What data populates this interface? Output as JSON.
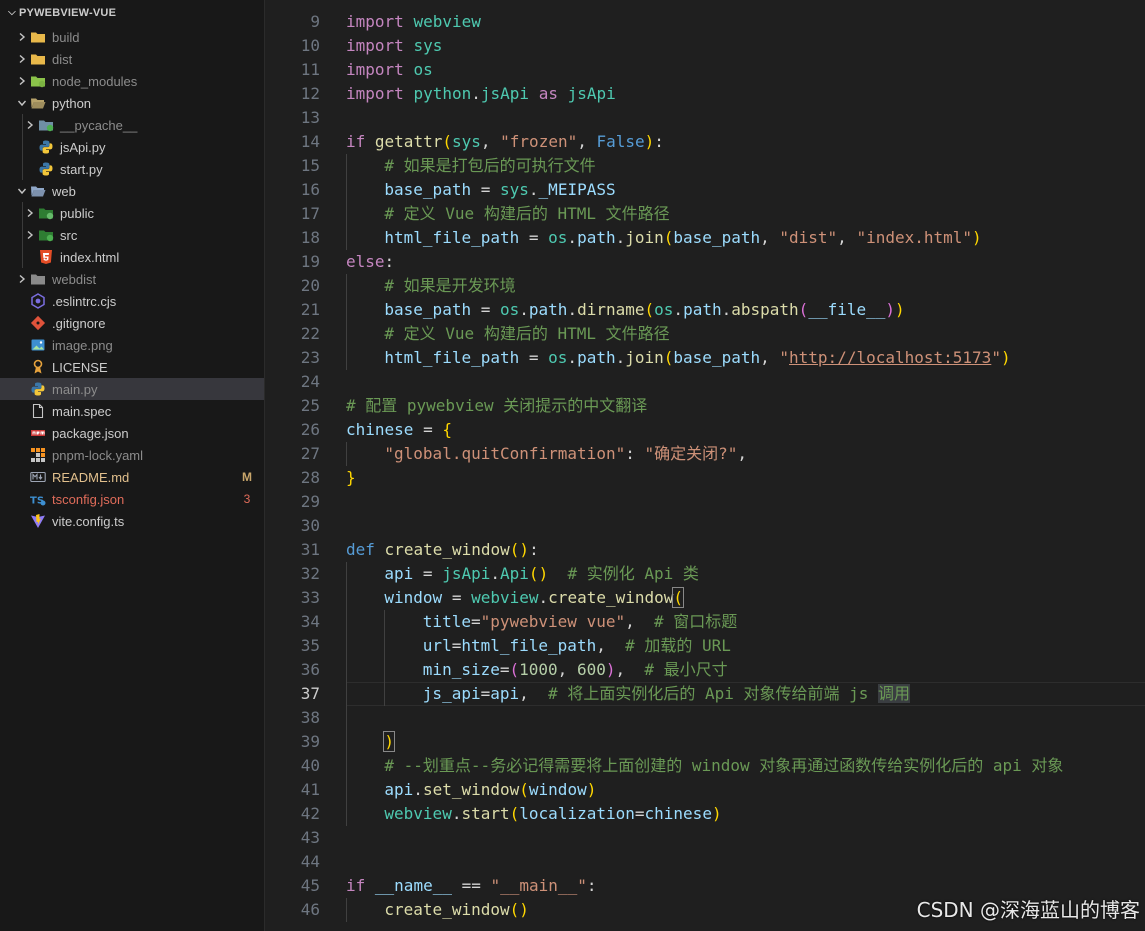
{
  "explorer": {
    "title": "PYWEBVIEW-VUE",
    "items": [
      {
        "label": "build",
        "kind": "folder",
        "icon": "folder-build-icon",
        "depth": 0,
        "expanded": false
      },
      {
        "label": "dist",
        "kind": "folder",
        "icon": "folder-dist-icon",
        "depth": 0,
        "expanded": false
      },
      {
        "label": "node_modules",
        "kind": "folder",
        "icon": "folder-node-icon",
        "depth": 0,
        "expanded": false
      },
      {
        "label": "python",
        "kind": "folder",
        "icon": "folder-python-icon",
        "depth": 0,
        "expanded": true
      },
      {
        "label": "__pycache__",
        "kind": "folder",
        "icon": "folder-pycache-icon",
        "depth": 1,
        "expanded": false
      },
      {
        "label": "jsApi.py",
        "kind": "file",
        "icon": "python-file-icon",
        "depth": 1
      },
      {
        "label": "start.py",
        "kind": "file",
        "icon": "python-file-icon",
        "depth": 1
      },
      {
        "label": "web",
        "kind": "folder",
        "icon": "folder-web-icon",
        "depth": 0,
        "expanded": true
      },
      {
        "label": "public",
        "kind": "folder",
        "icon": "folder-public-icon",
        "depth": 1,
        "expanded": false
      },
      {
        "label": "src",
        "kind": "folder",
        "icon": "folder-src-icon",
        "depth": 1,
        "expanded": false
      },
      {
        "label": "index.html",
        "kind": "file",
        "icon": "html-file-icon",
        "depth": 1
      },
      {
        "label": "webdist",
        "kind": "folder",
        "icon": "folder-icon",
        "depth": 0,
        "expanded": false
      },
      {
        "label": ".eslintrc.cjs",
        "kind": "file",
        "icon": "eslint-file-icon",
        "depth": 0
      },
      {
        "label": ".gitignore",
        "kind": "file",
        "icon": "git-file-icon",
        "depth": 0
      },
      {
        "label": "image.png",
        "kind": "file",
        "icon": "image-file-icon",
        "depth": 0
      },
      {
        "label": "LICENSE",
        "kind": "file",
        "icon": "license-file-icon",
        "depth": 0
      },
      {
        "label": "main.py",
        "kind": "file",
        "icon": "python-file-icon",
        "depth": 0,
        "selected": true
      },
      {
        "label": "main.spec",
        "kind": "file",
        "icon": "generic-file-icon",
        "depth": 0
      },
      {
        "label": "package.json",
        "kind": "file",
        "icon": "npm-file-icon",
        "depth": 0
      },
      {
        "label": "pnpm-lock.yaml",
        "kind": "file",
        "icon": "pnpm-file-icon",
        "depth": 0
      },
      {
        "label": "README.md",
        "kind": "file",
        "icon": "markdown-file-icon",
        "depth": 0,
        "badge": "M",
        "status": "modified"
      },
      {
        "label": "tsconfig.json",
        "kind": "file",
        "icon": "typescript-config-icon",
        "depth": 0,
        "badge": "3",
        "status": "error"
      },
      {
        "label": "vite.config.ts",
        "kind": "file",
        "icon": "vite-file-icon",
        "depth": 0
      }
    ]
  },
  "editor": {
    "active_line": 37,
    "lines": [
      {
        "n": 9,
        "indent": 0,
        "tokens": [
          [
            "kw2",
            "import"
          ],
          [
            "plain",
            " "
          ],
          [
            "mod",
            "webview"
          ]
        ]
      },
      {
        "n": 10,
        "indent": 0,
        "tokens": [
          [
            "kw2",
            "import"
          ],
          [
            "plain",
            " "
          ],
          [
            "mod",
            "sys"
          ]
        ]
      },
      {
        "n": 11,
        "indent": 0,
        "tokens": [
          [
            "kw2",
            "import"
          ],
          [
            "plain",
            " "
          ],
          [
            "mod",
            "os"
          ]
        ]
      },
      {
        "n": 12,
        "indent": 0,
        "tokens": [
          [
            "kw2",
            "import"
          ],
          [
            "plain",
            " "
          ],
          [
            "mod",
            "python"
          ],
          [
            "plain",
            "."
          ],
          [
            "mod",
            "jsApi"
          ],
          [
            "plain",
            " "
          ],
          [
            "kw2",
            "as"
          ],
          [
            "plain",
            " "
          ],
          [
            "mod",
            "jsApi"
          ]
        ]
      },
      {
        "n": 13,
        "indent": 0,
        "tokens": []
      },
      {
        "n": 14,
        "indent": 0,
        "tokens": [
          [
            "kw2",
            "if"
          ],
          [
            "plain",
            " "
          ],
          [
            "fn",
            "getattr"
          ],
          [
            "b1",
            "("
          ],
          [
            "mod",
            "sys"
          ],
          [
            "plain",
            ", "
          ],
          [
            "str",
            "\"frozen\""
          ],
          [
            "plain",
            ", "
          ],
          [
            "kw",
            "False"
          ],
          [
            "b1",
            ")"
          ],
          [
            "plain",
            ":"
          ]
        ]
      },
      {
        "n": 15,
        "indent": 1,
        "tokens": [
          [
            "cmt",
            "# 如果是打包后的可执行文件"
          ]
        ]
      },
      {
        "n": 16,
        "indent": 1,
        "tokens": [
          [
            "var",
            "base_path"
          ],
          [
            "plain",
            " = "
          ],
          [
            "mod",
            "sys"
          ],
          [
            "plain",
            "."
          ],
          [
            "var",
            "_MEIPASS"
          ]
        ]
      },
      {
        "n": 17,
        "indent": 1,
        "tokens": [
          [
            "cmt",
            "# 定义 Vue 构建后的 HTML 文件路径"
          ]
        ]
      },
      {
        "n": 18,
        "indent": 1,
        "tokens": [
          [
            "var",
            "html_file_path"
          ],
          [
            "plain",
            " = "
          ],
          [
            "mod",
            "os"
          ],
          [
            "plain",
            "."
          ],
          [
            "var",
            "path"
          ],
          [
            "plain",
            "."
          ],
          [
            "fn",
            "join"
          ],
          [
            "b1",
            "("
          ],
          [
            "var",
            "base_path"
          ],
          [
            "plain",
            ", "
          ],
          [
            "str",
            "\"dist\""
          ],
          [
            "plain",
            ", "
          ],
          [
            "str",
            "\"index.html\""
          ],
          [
            "b1",
            ")"
          ]
        ]
      },
      {
        "n": 19,
        "indent": 0,
        "tokens": [
          [
            "kw2",
            "else"
          ],
          [
            "plain",
            ":"
          ]
        ]
      },
      {
        "n": 20,
        "indent": 1,
        "tokens": [
          [
            "cmt",
            "# 如果是开发环境"
          ]
        ]
      },
      {
        "n": 21,
        "indent": 1,
        "tokens": [
          [
            "var",
            "base_path"
          ],
          [
            "plain",
            " = "
          ],
          [
            "mod",
            "os"
          ],
          [
            "plain",
            "."
          ],
          [
            "var",
            "path"
          ],
          [
            "plain",
            "."
          ],
          [
            "fn",
            "dirname"
          ],
          [
            "b1",
            "("
          ],
          [
            "mod",
            "os"
          ],
          [
            "plain",
            "."
          ],
          [
            "var",
            "path"
          ],
          [
            "plain",
            "."
          ],
          [
            "fn",
            "abspath"
          ],
          [
            "b2",
            "("
          ],
          [
            "var",
            "__file__"
          ],
          [
            "b2",
            ")"
          ],
          [
            "b1",
            ")"
          ]
        ]
      },
      {
        "n": 22,
        "indent": 1,
        "tokens": [
          [
            "cmt",
            "# 定义 Vue 构建后的 HTML 文件路径"
          ]
        ]
      },
      {
        "n": 23,
        "indent": 1,
        "tokens": [
          [
            "var",
            "html_file_path"
          ],
          [
            "plain",
            " = "
          ],
          [
            "mod",
            "os"
          ],
          [
            "plain",
            "."
          ],
          [
            "var",
            "path"
          ],
          [
            "plain",
            "."
          ],
          [
            "fn",
            "join"
          ],
          [
            "b1",
            "("
          ],
          [
            "var",
            "base_path"
          ],
          [
            "plain",
            ", "
          ],
          [
            "str",
            "\""
          ],
          [
            "url",
            "http://localhost:5173"
          ],
          [
            "str",
            "\""
          ],
          [
            "b1",
            ")"
          ]
        ]
      },
      {
        "n": 24,
        "indent": 0,
        "tokens": []
      },
      {
        "n": 25,
        "indent": 0,
        "tokens": [
          [
            "cmt",
            "# 配置 pywebview 关闭提示的中文翻译"
          ]
        ]
      },
      {
        "n": 26,
        "indent": 0,
        "tokens": [
          [
            "var",
            "chinese"
          ],
          [
            "plain",
            " = "
          ],
          [
            "b1",
            "{"
          ]
        ]
      },
      {
        "n": 27,
        "indent": 1,
        "tokens": [
          [
            "str",
            "\"global.quitConfirmation\""
          ],
          [
            "plain",
            ": "
          ],
          [
            "str",
            "\"确定关闭?\""
          ],
          [
            "plain",
            ","
          ]
        ]
      },
      {
        "n": 28,
        "indent": 0,
        "tokens": [
          [
            "b1",
            "}"
          ]
        ]
      },
      {
        "n": 29,
        "indent": 0,
        "tokens": []
      },
      {
        "n": 30,
        "indent": 0,
        "tokens": []
      },
      {
        "n": 31,
        "indent": 0,
        "tokens": [
          [
            "kw",
            "def"
          ],
          [
            "plain",
            " "
          ],
          [
            "fn",
            "create_window"
          ],
          [
            "b1",
            "("
          ],
          [
            "b1",
            ")"
          ],
          [
            "plain",
            ":"
          ]
        ]
      },
      {
        "n": 32,
        "indent": 1,
        "tokens": [
          [
            "var",
            "api"
          ],
          [
            "plain",
            " = "
          ],
          [
            "mod",
            "jsApi"
          ],
          [
            "plain",
            "."
          ],
          [
            "mod",
            "Api"
          ],
          [
            "b1",
            "("
          ],
          [
            "b1",
            ")"
          ],
          [
            "plain",
            "  "
          ],
          [
            "cmt",
            "# 实例化 Api 类"
          ]
        ]
      },
      {
        "n": 33,
        "indent": 1,
        "tokens": [
          [
            "var",
            "window"
          ],
          [
            "plain",
            " = "
          ],
          [
            "mod",
            "webview"
          ],
          [
            "plain",
            "."
          ],
          [
            "fn",
            "create_window"
          ],
          [
            "b1 bracket-match",
            "("
          ]
        ]
      },
      {
        "n": 34,
        "indent": 2,
        "tokens": [
          [
            "var",
            "title"
          ],
          [
            "plain",
            "="
          ],
          [
            "str",
            "\"pywebview vue\""
          ],
          [
            "plain",
            ",  "
          ],
          [
            "cmt",
            "# 窗口标题"
          ]
        ]
      },
      {
        "n": 35,
        "indent": 2,
        "tokens": [
          [
            "var",
            "url"
          ],
          [
            "plain",
            "="
          ],
          [
            "var",
            "html_file_path"
          ],
          [
            "plain",
            ",  "
          ],
          [
            "cmt",
            "# 加载的 URL"
          ]
        ]
      },
      {
        "n": 36,
        "indent": 2,
        "tokens": [
          [
            "var",
            "min_size"
          ],
          [
            "plain",
            "="
          ],
          [
            "b2",
            "("
          ],
          [
            "num",
            "1000"
          ],
          [
            "plain",
            ", "
          ],
          [
            "num",
            "600"
          ],
          [
            "b2",
            ")"
          ],
          [
            "plain",
            ",  "
          ],
          [
            "cmt",
            "# 最小尺寸"
          ]
        ]
      },
      {
        "n": 37,
        "indent": 2,
        "tokens": [
          [
            "var",
            "js_api"
          ],
          [
            "plain",
            "="
          ],
          [
            "var",
            "api"
          ],
          [
            "plain",
            ",  "
          ],
          [
            "cmt",
            "# 将上面实例化后的 Api 对象传给前端 js "
          ],
          [
            "cmt selword",
            "调用"
          ]
        ]
      },
      {
        "n": 38,
        "indent": 1,
        "tokens": []
      },
      {
        "n": 39,
        "indent": 1,
        "tokens": [
          [
            "b1 bracket-match",
            ")"
          ]
        ]
      },
      {
        "n": 40,
        "indent": 1,
        "tokens": [
          [
            "cmt",
            "# --划重点--务必记得需要将上面创建的 window 对象再通过函数传给实例化后的 api 对象"
          ]
        ]
      },
      {
        "n": 41,
        "indent": 1,
        "tokens": [
          [
            "var",
            "api"
          ],
          [
            "plain",
            "."
          ],
          [
            "fn",
            "set_window"
          ],
          [
            "b1",
            "("
          ],
          [
            "var",
            "window"
          ],
          [
            "b1",
            ")"
          ]
        ]
      },
      {
        "n": 42,
        "indent": 1,
        "tokens": [
          [
            "mod",
            "webview"
          ],
          [
            "plain",
            "."
          ],
          [
            "fn",
            "start"
          ],
          [
            "b1",
            "("
          ],
          [
            "var",
            "localization"
          ],
          [
            "plain",
            "="
          ],
          [
            "var",
            "chinese"
          ],
          [
            "b1",
            ")"
          ]
        ]
      },
      {
        "n": 43,
        "indent": 0,
        "tokens": []
      },
      {
        "n": 44,
        "indent": 0,
        "tokens": []
      },
      {
        "n": 45,
        "indent": 0,
        "tokens": [
          [
            "kw2",
            "if"
          ],
          [
            "plain",
            " "
          ],
          [
            "var",
            "__name__"
          ],
          [
            "plain",
            " == "
          ],
          [
            "str",
            "\"__main__\""
          ],
          [
            "plain",
            ":"
          ]
        ]
      },
      {
        "n": 46,
        "indent": 1,
        "tokens": [
          [
            "fn",
            "create_window"
          ],
          [
            "b1",
            "("
          ],
          [
            "b1",
            ")"
          ]
        ]
      }
    ]
  },
  "watermark": "CSDN @深海蓝山的博客",
  "colors": {
    "sidebar_bg": "#181818",
    "editor_bg": "#1f1f1f",
    "selected_row": "#37373d",
    "comment": "#6a9955",
    "keyword": "#c586c0",
    "string": "#ce9178",
    "function": "#dcdcaa",
    "type": "#4ec9b0",
    "variable": "#9cdcfe"
  }
}
